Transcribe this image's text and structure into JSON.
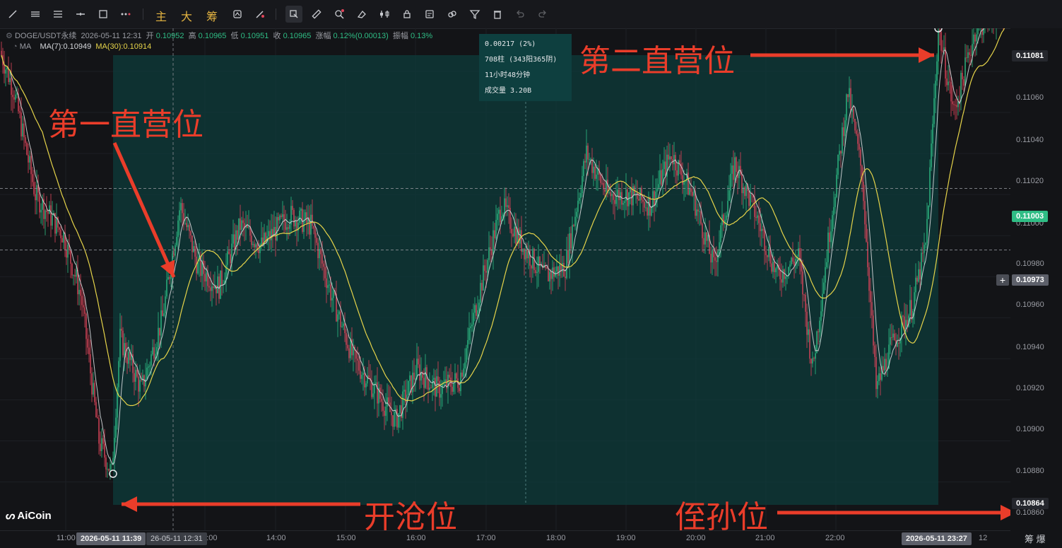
{
  "toolbar": {
    "tools": [
      "trend-line-tool",
      "horizontal-ray-tool",
      "parallel-channel-tool",
      "horizontal-line-tool",
      "rectangle-tool",
      "more-tools"
    ],
    "text_buttons": [
      "主",
      "大",
      "筹"
    ],
    "tools2": [
      "magnet-tool",
      "brush-tool",
      "select-tool",
      "ruler-tool",
      "zoom-alert-tool",
      "eraser-tool",
      "compare-tool",
      "lock-tool",
      "save-template-tool",
      "link-tool",
      "filter-tool",
      "delete-tool",
      "undo-tool",
      "redo-tool"
    ]
  },
  "legend": {
    "symbol": "DOGE/USDT永续",
    "time": "2026-05-11 12:31",
    "open_label": "开",
    "open": "0.10952",
    "high_label": "高",
    "high": "0.10965",
    "low_label": "低",
    "low": "0.10951",
    "close_label": "收",
    "close": "0.10965",
    "change_label": "涨幅",
    "change": "0.12%(0.00013)",
    "amplitude_label": "振幅",
    "amplitude": "0.13%",
    "ma_indicator": "MA",
    "ma7": "MA(7):0.10949",
    "ma30": "MA(30):0.10914"
  },
  "measure": {
    "line1": "0.00217 (2%)",
    "line2": "708柱 (343阳365阴)",
    "line3": "11小时48分钟",
    "line4": "成交量 3.20B"
  },
  "annotations": {
    "first": "第一直营位",
    "second": "第二直营位",
    "entry": "开沧位",
    "stop": "侄孙位"
  },
  "price_axis": {
    "ticks": [
      "0.11060",
      "0.11040",
      "0.11020",
      "0.11000",
      "0.10980",
      "0.10960",
      "0.10940",
      "0.10920",
      "0.10900",
      "0.10880",
      "0.10860"
    ],
    "tag_high": "0.11081",
    "tag_last": "0.11003",
    "tag_cursor": "0.10973",
    "tag_low": "0.10864"
  },
  "time_axis": {
    "ticks": [
      "11:00",
      "13:00",
      "14:00",
      "15:00",
      "16:00",
      "17:00",
      "18:00",
      "19:00",
      "20:00",
      "21:00",
      "22:00"
    ],
    "tag_start": "2026-05-11 11:39",
    "tag_cursor": "26-05-11 12:31",
    "tag_end": "2026-05-11 23:27",
    "right_label": "12"
  },
  "logo": "AiCoin",
  "corner": "筹 爆",
  "colors": {
    "bg": "#131417",
    "up": "#2fbd85",
    "down": "#e0455a",
    "ma7": "#d6d8dc",
    "ma30": "#e6d44a",
    "measure_fill": "#0d3b3b",
    "annotation": "#ea3d2a"
  }
}
